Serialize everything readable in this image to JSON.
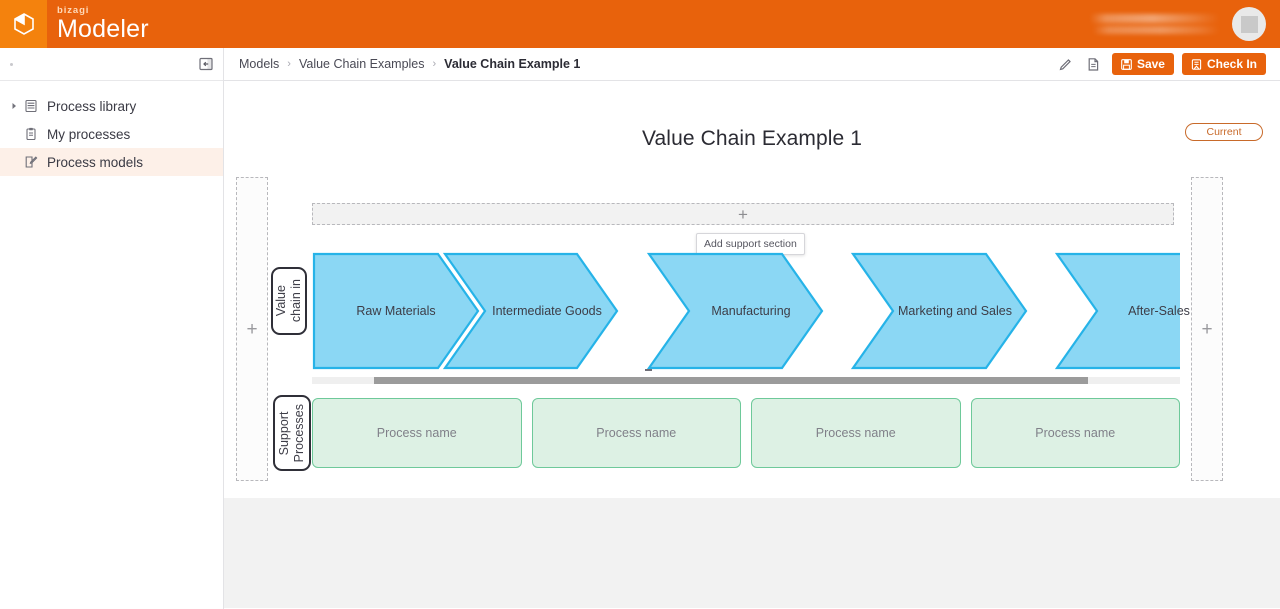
{
  "app": {
    "brand_sub": "bizagi",
    "brand_main": "Modeler",
    "logo_icon": "cube-icon",
    "avatar_icon": "user-avatar"
  },
  "sidebar": {
    "collapse_icon": "collapse-panel-icon",
    "items": [
      {
        "label": "Process library",
        "icon": "library-icon",
        "has_caret": true,
        "active": false
      },
      {
        "label": "My processes",
        "icon": "clipboard-icon",
        "has_caret": false,
        "active": false
      },
      {
        "label": "Process models",
        "icon": "edit-document-icon",
        "has_caret": false,
        "active": true
      }
    ]
  },
  "header": {
    "breadcrumb": [
      {
        "label": "Models",
        "current": false
      },
      {
        "label": "Value Chain Examples",
        "current": false
      },
      {
        "label": "Value Chain Example 1",
        "current": true
      }
    ],
    "separator": "›",
    "edit_icon": "pencil-icon",
    "doc_icon": "document-icon",
    "save_label": "Save",
    "save_icon": "floppy-disk-icon",
    "checkin_label": "Check In",
    "checkin_icon": "check-in-icon"
  },
  "canvas": {
    "title": "Value Chain Example 1",
    "version_badge": "Current",
    "add_column_left_icon": "plus-icon",
    "add_column_right_icon": "plus-icon",
    "add_support_section_icon": "plus-icon",
    "tooltip": "Add support section",
    "lanes": {
      "value_chain_label": "Value\nchain in",
      "support_label": "Support\nProcesses"
    },
    "value_chain_steps": [
      {
        "label": "Raw Materials"
      },
      {
        "label": "Intermediate Goods"
      },
      {
        "label": "Manufacturing"
      },
      {
        "label": "Marketing and Sales"
      },
      {
        "label": "After-Sales"
      }
    ],
    "support_processes": [
      {
        "label": "Process name"
      },
      {
        "label": "Process name"
      },
      {
        "label": "Process name"
      },
      {
        "label": "Process name"
      }
    ],
    "scrollbar": {
      "orientation": "horizontal"
    }
  },
  "colors": {
    "brand_orange": "#e8620c",
    "brand_orange_light": "#f4820d",
    "chevron_fill": "#8bd7f4",
    "chevron_stroke": "#26b3e8",
    "support_fill": "#ddf1e4",
    "support_stroke": "#6ec99a",
    "active_nav_bg": "#fdf0e8"
  }
}
